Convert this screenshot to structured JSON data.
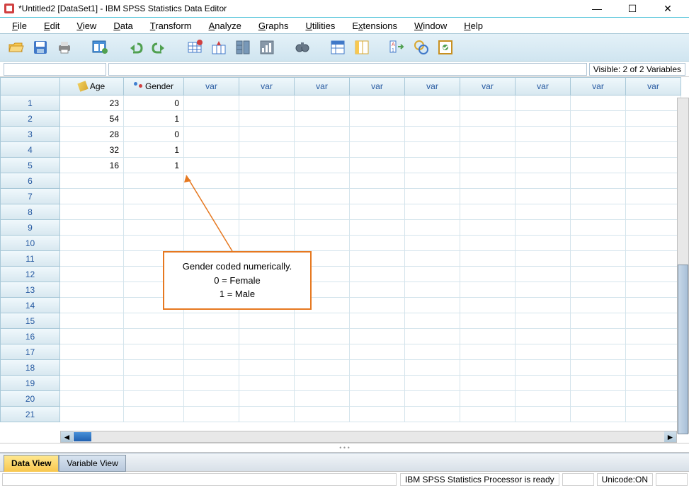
{
  "window": {
    "title": "*Untitled2 [DataSet1] - IBM SPSS Statistics Data Editor"
  },
  "menu": {
    "file": "File",
    "edit": "Edit",
    "view": "View",
    "data": "Data",
    "transform": "Transform",
    "analyze": "Analyze",
    "graphs": "Graphs",
    "utilities": "Utilities",
    "extensions": "Extensions",
    "window": "Window",
    "help": "Help"
  },
  "infobar": {
    "visible": "Visible: 2 of 2 Variables"
  },
  "columns": {
    "age": "Age",
    "gender": "Gender",
    "var": "var"
  },
  "rows": [
    "1",
    "2",
    "3",
    "4",
    "5",
    "6",
    "7",
    "8",
    "9",
    "10",
    "11",
    "12",
    "13",
    "14",
    "15",
    "16",
    "17",
    "18",
    "19",
    "20",
    "21"
  ],
  "data": [
    {
      "age": "23",
      "gender": "0"
    },
    {
      "age": "54",
      "gender": "1"
    },
    {
      "age": "28",
      "gender": "0"
    },
    {
      "age": "32",
      "gender": "1"
    },
    {
      "age": "16",
      "gender": "1"
    }
  ],
  "annotation": {
    "line1": "Gender coded numerically.",
    "line2": "0 = Female",
    "line3": "1 = Male"
  },
  "tabs": {
    "data_view": "Data View",
    "variable_view": "Variable View"
  },
  "status": {
    "processor": "IBM SPSS Statistics Processor is ready",
    "unicode": "Unicode:ON"
  }
}
